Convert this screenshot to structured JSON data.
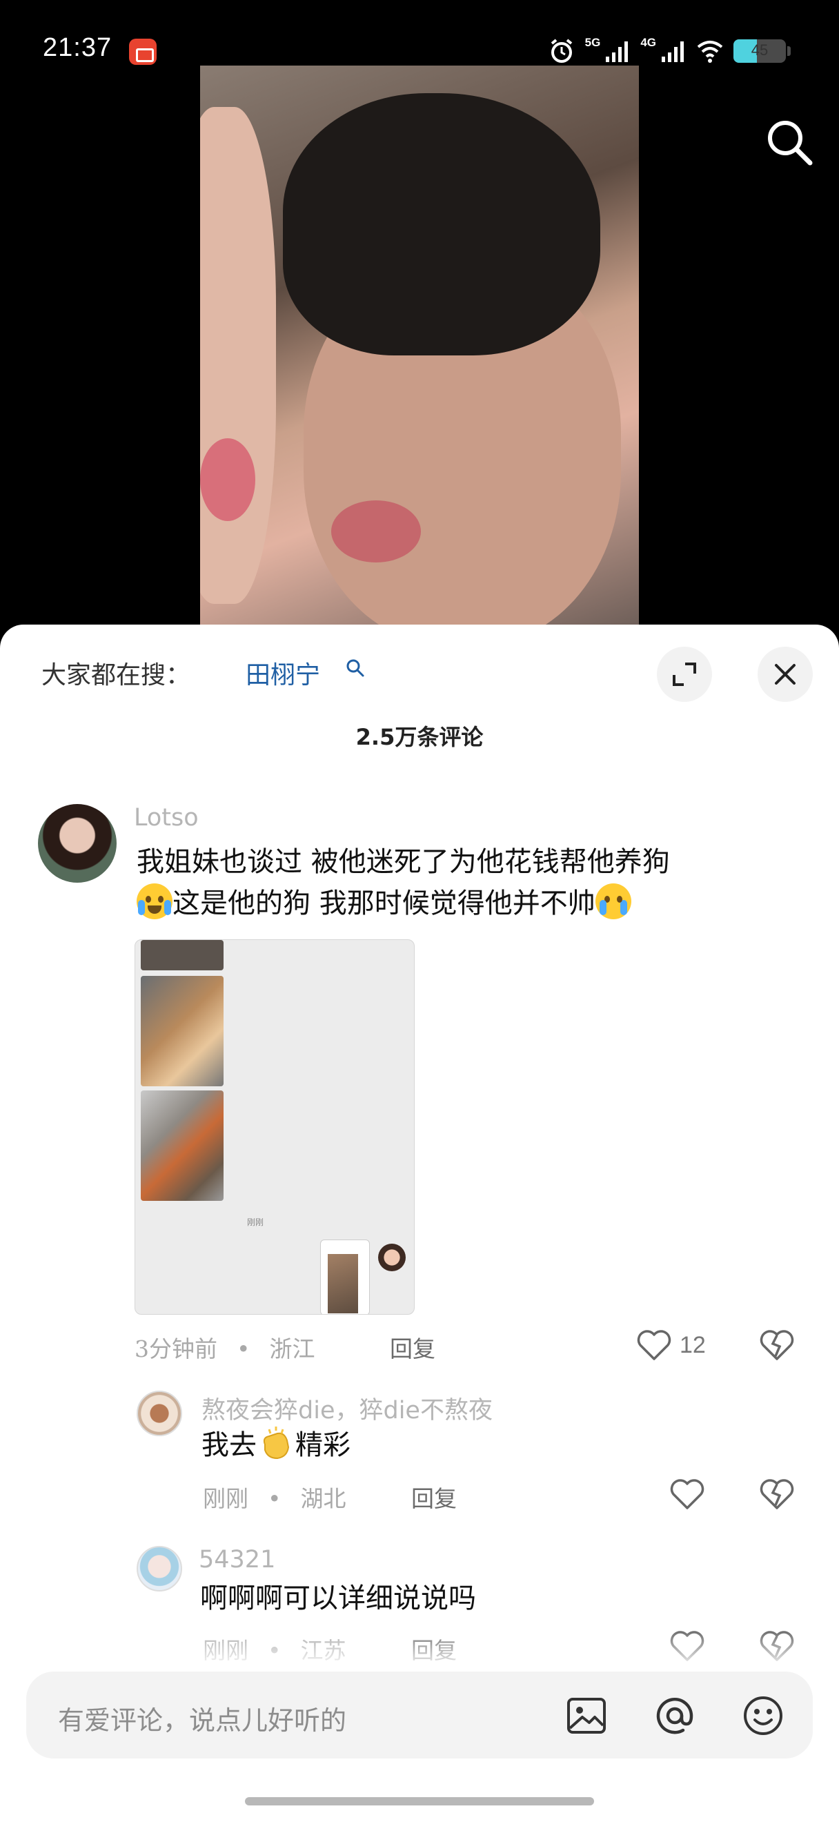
{
  "status_bar": {
    "time": "21:37",
    "network_1": "5G",
    "network_2": "4G",
    "battery": "45",
    "battery_level": 0.45
  },
  "sheet": {
    "hot_search_label": "大家都在搜：",
    "hot_search_term": "田栩宁",
    "comment_count": "2.5万条评论"
  },
  "comments": [
    {
      "user": "Lotso",
      "text_line1": "我姐妹也谈过 被他迷死了为他花钱帮他养狗",
      "text_line2": "这是他的狗 我那时候觉得他并不帅",
      "attachment_tiny_text": "刚刚",
      "time": "3分钟前",
      "location": "浙江",
      "reply_label": "回复",
      "likes": "12"
    },
    {
      "user": "熬夜会猝die，猝die不熬夜",
      "text_before": "我去",
      "text_after": "精彩",
      "time": "刚刚",
      "location": "湖北",
      "reply_label": "回复"
    },
    {
      "user": "54321",
      "text": "啊啊啊可以详细说说吗",
      "time": "刚刚",
      "location": "江苏",
      "reply_label": "回复"
    }
  ],
  "input": {
    "placeholder": "有爱评论，说点儿好听的",
    "icons": [
      "image-icon",
      "at-icon",
      "emoji-icon"
    ]
  },
  "colors": {
    "accent_link": "#1f5fa4",
    "battery": "#4fd2df"
  }
}
